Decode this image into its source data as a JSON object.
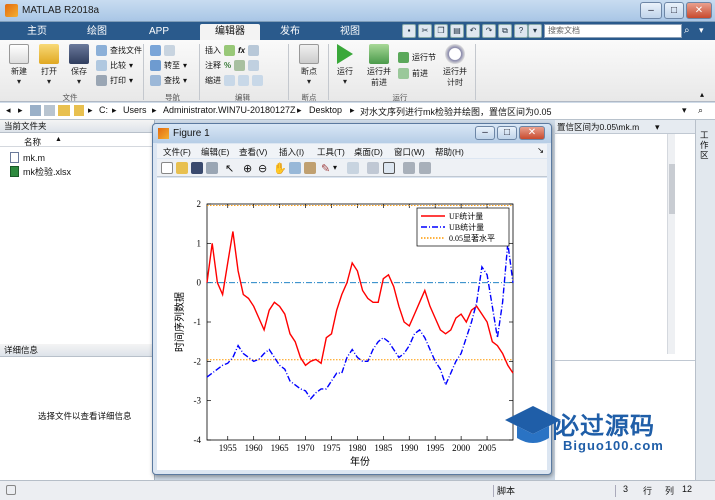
{
  "app": {
    "title": "MATLAB R2018a"
  },
  "tabs": [
    "主页",
    "绘图",
    "APP",
    "编辑器",
    "发布",
    "视图"
  ],
  "active_tab": "编辑器",
  "search": {
    "placeholder": "搜索文档"
  },
  "ribbon": {
    "file_group": {
      "label": "文件",
      "new": "新建",
      "open": "打开",
      "save": "保存",
      "find_files": "查找文件",
      "compare": "比较",
      "print": "打印"
    },
    "nav_group": {
      "label": "导航",
      "goto": "转至",
      "find": "查找"
    },
    "edit_group": {
      "label": "编辑",
      "insert": "插入",
      "comment": "注释",
      "indent": "缩进"
    },
    "breakpoint_group": {
      "label": "断点",
      "breakpoints": "断点"
    },
    "run_group": {
      "label": "运行",
      "run": "运行",
      "run_advance_1": "运行并",
      "run_advance_2": "前进",
      "run_section": "运行节",
      "advance": "前进",
      "run_time_1": "运行并",
      "run_time_2": "计时"
    }
  },
  "address": {
    "parts": [
      "C:",
      "Users",
      "Administrator.WIN7U-20180127Z",
      "Desktop",
      "对水文序列进行mk检验并绘图，置信区间为0.05"
    ]
  },
  "left_panel": {
    "header": "当前文件夹",
    "column": "名称",
    "sort_indicator": "▲",
    "files": [
      {
        "name": "mk.m",
        "icon": "m-file-icon"
      },
      {
        "name": "mk检验.xlsx",
        "icon": "excel-file-icon"
      }
    ],
    "details_header": "详细信息",
    "details_text": "选择文件以查看详细信息"
  },
  "editor_tab_text": "置信区间为0.05\\mk.m",
  "side_tab": "工作区",
  "figure": {
    "title": "Figure 1",
    "menu": [
      "文件(F)",
      "编辑(E)",
      "查看(V)",
      "插入(I)",
      "工具(T)",
      "桌面(D)",
      "窗口(W)",
      "帮助(H)"
    ]
  },
  "status": {
    "mode": "脚本",
    "row_label": "行",
    "row": "3",
    "col_label": "列",
    "col": "12"
  },
  "watermark": {
    "cn": "必过源码",
    "url": "Biguo100.com"
  },
  "colors": {
    "uf": "#ff0000",
    "ub": "#0000ff",
    "zero": "#0072bd",
    "sig": "#ff9900",
    "ribbon_tab": "#2a5a8c"
  },
  "chart_data": {
    "type": "line",
    "xlabel": "年份",
    "ylabel": "时间序列数据",
    "xlim": [
      1951,
      2010
    ],
    "ylim": [
      -4,
      2
    ],
    "xticks": [
      1955,
      1960,
      1965,
      1970,
      1975,
      1980,
      1985,
      1990,
      1995,
      2000,
      2005
    ],
    "yticks": [
      -4,
      -3,
      -2,
      -1,
      0,
      1,
      2
    ],
    "legend_position": "top-right",
    "hlines": [
      {
        "y": 0,
        "style": "dash-dot",
        "color": "#0072bd"
      },
      {
        "y": 1.96,
        "style": "dotted",
        "color": "#ff9900"
      },
      {
        "y": -1.96,
        "style": "dotted",
        "color": "#ff9900"
      }
    ],
    "series": [
      {
        "name": "UF统计量",
        "style": "solid",
        "color": "#ff0000",
        "x": [
          1951,
          1952,
          1953,
          1954,
          1955,
          1956,
          1957,
          1958,
          1959,
          1960,
          1961,
          1962,
          1963,
          1964,
          1965,
          1966,
          1967,
          1968,
          1969,
          1970,
          1971,
          1972,
          1973,
          1974,
          1975,
          1976,
          1977,
          1978,
          1979,
          1980,
          1981,
          1982,
          1983,
          1984,
          1985,
          1986,
          1987,
          1988,
          1989,
          1990,
          1991,
          1992,
          1993,
          1994,
          1995,
          1996,
          1997,
          1998,
          1999,
          2000,
          2001,
          2002,
          2003,
          2004,
          2005,
          2006,
          2007,
          2008,
          2009,
          2010
        ],
        "y": [
          0,
          1,
          0,
          -0.3,
          0.5,
          1.3,
          0.3,
          -0.3,
          -0.4,
          -0.6,
          -0.9,
          -1.2,
          -0.7,
          -0.5,
          -0.6,
          -0.8,
          -1.3,
          -1.5,
          -1.9,
          -2.1,
          -2.0,
          -1.95,
          -2.05,
          -1.4,
          -1.3,
          -0.7,
          -0.3,
          0,
          0.5,
          0.3,
          -0.2,
          -0.4,
          -0.5,
          -0.5,
          0.1,
          0.2,
          -0.1,
          -0.6,
          -1.0,
          -1.1,
          -0.8,
          -0.5,
          -0.2,
          -0.6,
          -0.9,
          -1.2,
          -1.3,
          -1.2,
          -0.9,
          -0.8,
          -1.0,
          -0.7,
          -0.6,
          -0.8,
          -1.0,
          -1.5,
          -1.6,
          -1.8,
          -2.1,
          -2.3
        ]
      },
      {
        "name": "UB统计量",
        "style": "dash-dot",
        "color": "#0000ff",
        "x": [
          1951,
          1952,
          1953,
          1954,
          1955,
          1956,
          1957,
          1958,
          1959,
          1960,
          1961,
          1962,
          1963,
          1964,
          1965,
          1966,
          1967,
          1968,
          1969,
          1970,
          1971,
          1972,
          1973,
          1974,
          1975,
          1976,
          1977,
          1978,
          1979,
          1980,
          1981,
          1982,
          1983,
          1984,
          1985,
          1986,
          1987,
          1988,
          1989,
          1990,
          1991,
          1992,
          1993,
          1994,
          1995,
          1996,
          1997,
          1998,
          1999,
          2000,
          2001,
          2002,
          2003,
          2004,
          2005,
          2006,
          2007,
          2008,
          2009,
          2010
        ],
        "y": [
          -2.4,
          -2.3,
          -2.2,
          -2.1,
          -2.05,
          -1.9,
          -1.6,
          -1.8,
          -1.9,
          -2.0,
          -1.95,
          -1.8,
          -1.7,
          -1.9,
          -2.1,
          -2.2,
          -2.5,
          -2.6,
          -2.7,
          -2.75,
          -2.95,
          -2.8,
          -2.7,
          -2.7,
          -2.5,
          -2.3,
          -2.3,
          -1.9,
          -1.7,
          -1.9,
          -2.0,
          -2.0,
          -1.7,
          -1.5,
          -1.4,
          -1.5,
          -1.7,
          -1.9,
          -1.8,
          -1.6,
          -1.3,
          -1.2,
          -1.4,
          -1.7,
          -2.0,
          -2.2,
          -2.6,
          -2.3,
          -2.0,
          -1.8,
          -1.4,
          -1.0,
          -0.5,
          0.4,
          0.2,
          -0.6,
          -1.4,
          -0.5,
          1.0,
          0
        ]
      },
      {
        "name": "0.05显著水平",
        "style": "dotted",
        "color": "#ff9900",
        "x": [
          1951,
          2010
        ],
        "y": [
          1.96,
          1.96
        ]
      }
    ]
  }
}
